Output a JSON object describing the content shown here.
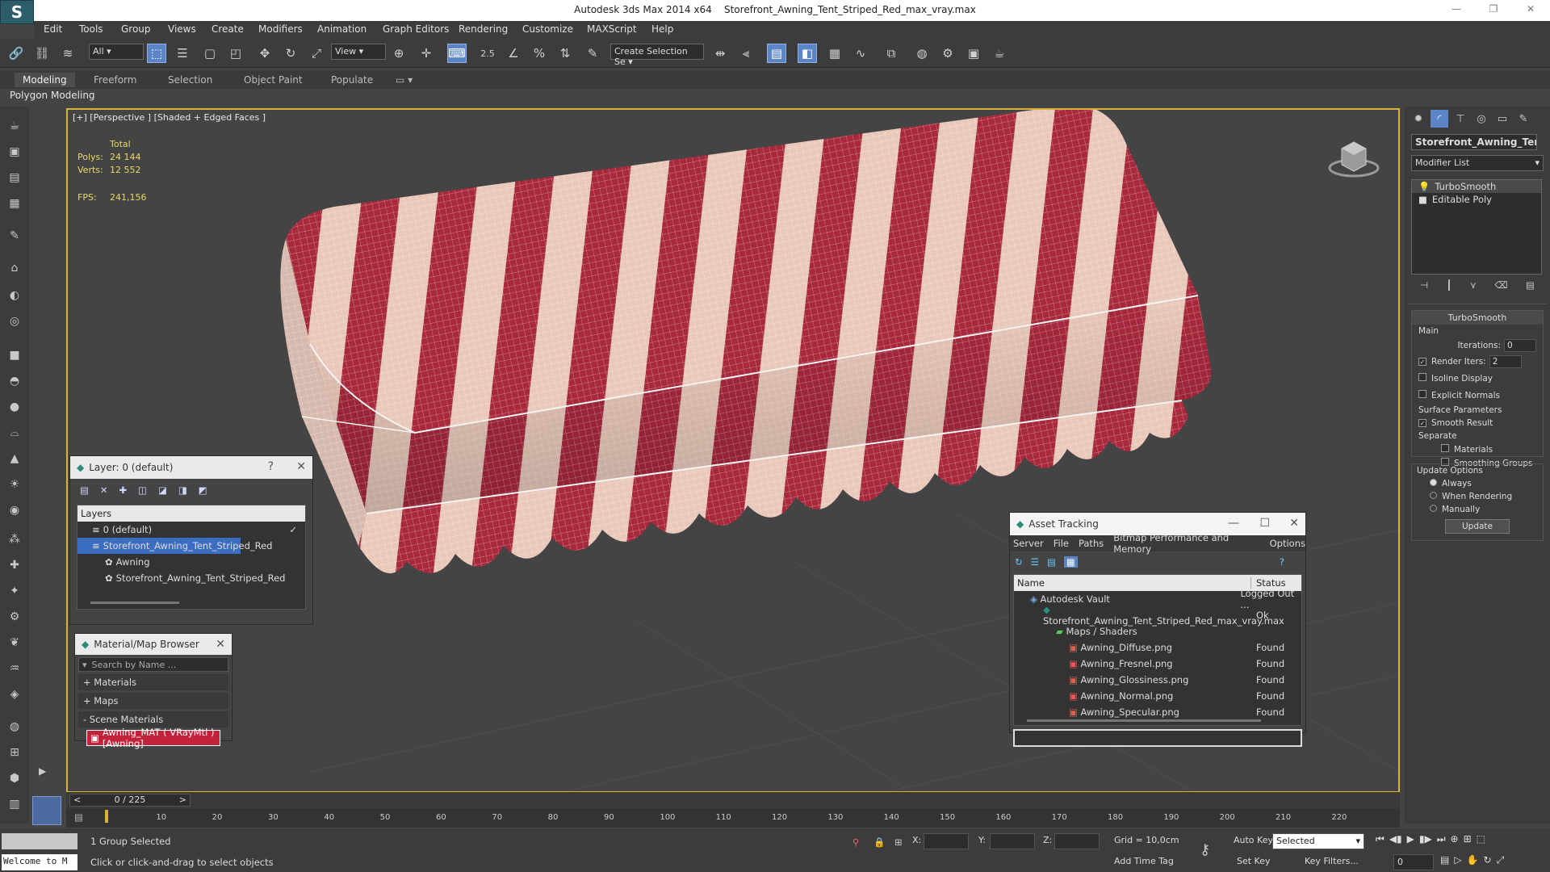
{
  "window": {
    "app_title": "Autodesk 3ds Max  2014 x64",
    "file": "Storefront_Awning_Tent_Striped_Red_max_vray.max"
  },
  "menu": [
    "Edit",
    "Tools",
    "Group",
    "Views",
    "Create",
    "Modifiers",
    "Animation",
    "Graph Editors",
    "Rendering",
    "Customize",
    "MAXScript",
    "Help"
  ],
  "toolbar": {
    "filter": "All",
    "ref_coord": "View",
    "selection_set": "Create Selection Se",
    "snap_value": "2.5"
  },
  "ribbon": {
    "tabs": [
      "Modeling",
      "Freeform",
      "Selection",
      "Object Paint",
      "Populate"
    ],
    "sub": "Polygon Modeling"
  },
  "viewport": {
    "label": "[+] [Perspective ] [Shaded + Edged Faces ]",
    "total_label": "Total",
    "polys_label": "Polys:",
    "polys": "24 144",
    "verts_label": "Verts:",
    "verts": "12 552",
    "fps_label": "FPS:",
    "fps": "241,156"
  },
  "command_panel": {
    "object_name": "Storefront_Awning_Tent",
    "modifier_list": "Modifier List",
    "stack": [
      "TurboSmooth",
      "Editable Poly"
    ],
    "turbosmooth": {
      "title": "TurboSmooth",
      "main": "Main",
      "iterations_label": "Iterations:",
      "iterations": "0",
      "render_iters_label": "Render Iters:",
      "render_iters": "2",
      "isoline": "Isoline Display",
      "explicit": "Explicit Normals",
      "surface": "Surface Parameters",
      "smooth_result": "Smooth Result",
      "separate": "Separate",
      "materials": "Materials",
      "smoothing_groups": "Smoothing Groups",
      "update_options": "Update Options",
      "always": "Always",
      "when_rendering": "When Rendering",
      "manually": "Manually",
      "update_btn": "Update"
    }
  },
  "layer_panel": {
    "title": "Layer: 0 (default)",
    "help": "?",
    "header": "Layers",
    "items": [
      "0 (default)",
      "Storefront_Awning_Tent_Striped_Red",
      "Awning",
      "Storefront_Awning_Tent_Striped_Red"
    ]
  },
  "material_browser": {
    "title": "Material/Map Browser",
    "search_placeholder": "Search by Name ...",
    "sections": [
      "+ Materials",
      "+ Maps",
      "- Scene Materials"
    ],
    "scene_material": "Awning_MAT  ( VRayMtl )  [Awning]"
  },
  "asset_tracking": {
    "title": "Asset Tracking",
    "menu": [
      "Server",
      "File",
      "Paths",
      "Bitmap Performance and Memory",
      "Options"
    ],
    "col_name": "Name",
    "col_status": "Status",
    "rows": [
      {
        "name": "Autodesk Vault",
        "status": "Logged Out ..."
      },
      {
        "name": "Storefront_Awning_Tent_Striped_Red_max_vray.max",
        "status": "Ok"
      },
      {
        "name": "Maps / Shaders",
        "status": ""
      },
      {
        "name": "Awning_Diffuse.png",
        "status": "Found"
      },
      {
        "name": "Awning_Fresnel.png",
        "status": "Found"
      },
      {
        "name": "Awning_Glossiness.png",
        "status": "Found"
      },
      {
        "name": "Awning_Normal.png",
        "status": "Found"
      },
      {
        "name": "Awning_Specular.png",
        "status": "Found"
      }
    ]
  },
  "timeline": {
    "frame": "0 / 225",
    "ticks": [
      "10",
      "20",
      "30",
      "40",
      "50",
      "60",
      "70",
      "80",
      "90",
      "100",
      "110",
      "120",
      "130",
      "140",
      "150",
      "160",
      "170",
      "180",
      "190",
      "200",
      "210",
      "220"
    ]
  },
  "status": {
    "welcome": "Welcome to M",
    "selected": "1 Group Selected",
    "hint": "Click or click-and-drag to select objects",
    "x_label": "X:",
    "y_label": "Y:",
    "z_label": "Z:",
    "grid": "Grid = 10,0cm",
    "add_time_tag": "Add Time Tag",
    "auto_key": "Auto Key",
    "set_key": "Set Key",
    "selected_dd": "Selected",
    "key_filters": "Key Filters...",
    "frame_field": "0"
  },
  "colors": {
    "accent": "#d9b23a",
    "stripe_red": "#a8283c",
    "stripe_light": "#e9c7b9"
  }
}
